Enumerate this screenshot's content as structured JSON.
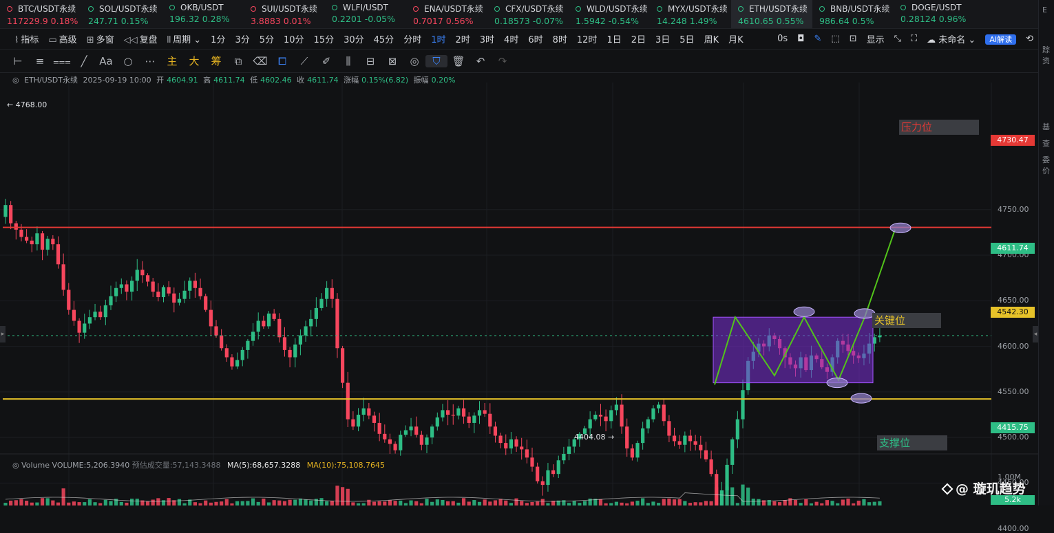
{
  "tickers": [
    {
      "name": "BTC/USDT永续",
      "price": "117229.9",
      "change": "0.18%",
      "dir": "down"
    },
    {
      "name": "SOL/USDT永续",
      "price": "247.71",
      "change": "0.15%",
      "dir": "up"
    },
    {
      "name": "OKB/USDT",
      "price": "196.32",
      "change": "0.28%",
      "dir": "up"
    },
    {
      "name": "SUI/USDT永续",
      "price": "3.8883",
      "change": "0.01%",
      "dir": "down"
    },
    {
      "name": "WLFI/USDT",
      "price": "0.2201",
      "change": "-0.05%",
      "dir": "up"
    },
    {
      "name": "ENA/USDT永续",
      "price": "0.7017",
      "change": "0.56%",
      "dir": "down"
    },
    {
      "name": "CFX/USDT永续",
      "price": "0.18573",
      "change": "-0.07%",
      "dir": "up"
    },
    {
      "name": "WLD/USDT永续",
      "price": "1.5942",
      "change": "-0.54%",
      "dir": "up"
    },
    {
      "name": "MYX/USDT永续",
      "price": "14.248",
      "change": "1.49%",
      "dir": "up"
    },
    {
      "name": "ETH/USDT永续",
      "price": "4610.65",
      "change": "0.55%",
      "dir": "up",
      "active": true
    },
    {
      "name": "BNB/USDT永续",
      "price": "986.64",
      "change": "0.5%",
      "dir": "up"
    },
    {
      "name": "DOGE/USDT",
      "price": "0.28124",
      "change": "0.96%",
      "dir": "up"
    }
  ],
  "toolbar": {
    "indicator": "指标",
    "advanced": "高级",
    "multi": "多窗",
    "replay": "复盘",
    "period": "周期",
    "intervals": [
      "1分",
      "3分",
      "5分",
      "10分",
      "15分",
      "30分",
      "45分",
      "分时",
      "1时",
      "2时",
      "3时",
      "4时",
      "6时",
      "8时",
      "12时",
      "1日",
      "2日",
      "3日",
      "5日",
      "周K",
      "月K"
    ],
    "active_interval": "1时",
    "countdown": "0s",
    "display": "显示",
    "unnamed": "未命名",
    "ai": "AI解读"
  },
  "drawtools": {
    "main": "主",
    "big": "大",
    "chip": "筹",
    "text": "Aa"
  },
  "ohlc": {
    "symbol": "ETH/USDT永续",
    "time": "2025-09-19 10:00",
    "open_label": "开",
    "open": "4604.91",
    "high_label": "高",
    "high": "4611.74",
    "low_label": "低",
    "low": "4602.46",
    "close_label": "收",
    "close": "4611.74",
    "chg_label": "涨幅",
    "chg": "0.15%(6.82)",
    "amp_label": "振幅",
    "amp": "0.20%"
  },
  "volume": {
    "label": "Volume",
    "vol": "VOLUME:5,206.3940",
    "est": "预估成交量:57,143.3488",
    "ma5": "MA(5):68,657.3288",
    "ma10": "MA(10):75,108.7645",
    "axis_top": "1.00M",
    "current": "5.2k"
  },
  "price_axis": [
    "4750.00",
    "4700.00",
    "4650.00",
    "4600.00",
    "4550.00",
    "4500.00",
    "4450.00",
    "4400.00"
  ],
  "price_tags": {
    "resistance": {
      "value": "4730.47",
      "color": "#e53935"
    },
    "current": {
      "value": "4611.74",
      "color": "#2ebd85"
    },
    "key": {
      "value": "4542.30",
      "color": "#e6c229"
    },
    "support": {
      "value": "4415.75",
      "color": "#2ebd85"
    }
  },
  "extremes": {
    "high": "4768.00",
    "low": "4404.08"
  },
  "annotations": {
    "resistance": "压力位",
    "key": "关键位",
    "support": "支撑位"
  },
  "watermark": "@ 璇玑趋势",
  "side": [
    "E",
    "踪",
    "资",
    "基",
    "查",
    "委",
    "价"
  ],
  "colors": {
    "up": "#2ebd85",
    "down": "#f6465d",
    "box": "#7b2fd6"
  },
  "chart_data": {
    "type": "candlestick",
    "symbol": "ETH/USDT永续",
    "interval": "1时",
    "ylim": [
      4380,
      4780
    ],
    "levels": {
      "resistance": 4730.47,
      "key": 4542.3,
      "support": 4415.75,
      "current": 4611.74
    },
    "high": 4768.0,
    "low": 4404.08,
    "closes": [
      4755,
      4735,
      4728,
      4720,
      4716,
      4712,
      4724,
      4706,
      4718,
      4712,
      4690,
      4662,
      4640,
      4628,
      4615,
      4625,
      4632,
      4638,
      4632,
      4645,
      4655,
      4664,
      4668,
      4660,
      4672,
      4684,
      4678,
      4671,
      4660,
      4654,
      4665,
      4658,
      4648,
      4652,
      4661,
      4672,
      4664,
      4655,
      4640,
      4622,
      4612,
      4598,
      4588,
      4578,
      4585,
      4596,
      4606,
      4616,
      4628,
      4622,
      4636,
      4630,
      4610,
      4596,
      4588,
      4602,
      4612,
      4622,
      4630,
      4642,
      4652,
      4664,
      4652,
      4598,
      4560,
      4520,
      4512,
      4525,
      4532,
      4524,
      4516,
      4504,
      4498,
      4493,
      4486,
      4503,
      4508,
      4512,
      4503,
      4492,
      4500,
      4512,
      4522,
      4530,
      4525,
      4524,
      4532,
      4523,
      4516,
      4524,
      4530,
      4526,
      4512,
      4502,
      4494,
      4488,
      4498,
      4490,
      4487,
      4478,
      4468,
      4452,
      4448,
      4464,
      4460,
      4475,
      4482,
      4490,
      4498,
      4504,
      4510,
      4520,
      4525,
      4523,
      4518,
      4530,
      4536,
      4512,
      4488,
      4478,
      4494,
      4510,
      4520,
      4532,
      4536,
      4518,
      4502,
      4496,
      4492,
      4502,
      4496,
      4492,
      4486,
      4476,
      4460,
      4420,
      4442,
      4470,
      4498,
      4520,
      4552,
      4584,
      4594,
      4603,
      4600,
      4612,
      4608,
      4598,
      4588,
      4580,
      4576,
      4588,
      4574,
      4590,
      4586,
      4577,
      4572,
      4588,
      4606,
      4602,
      4595,
      4590,
      4587,
      4592,
      4603,
      4610,
      4612
    ]
  }
}
